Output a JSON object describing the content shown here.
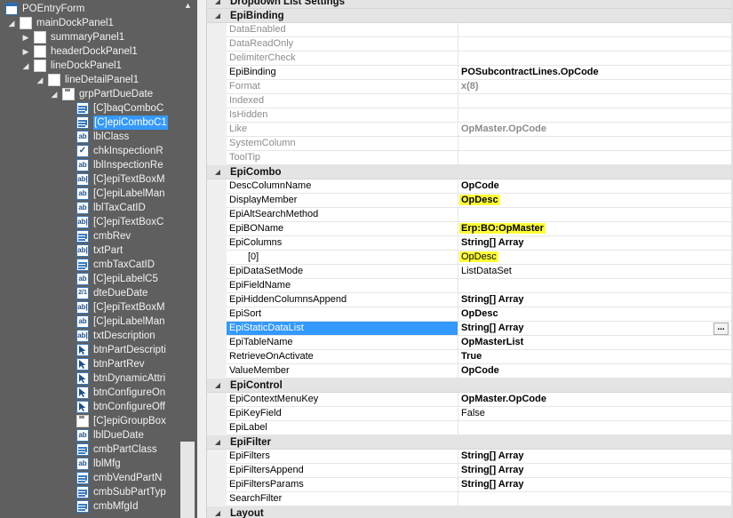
{
  "tree": {
    "nodes": [
      {
        "label": "POEntryForm",
        "icon": "form-icon",
        "expander": "",
        "level": 0
      },
      {
        "label": "mainDockPanel1",
        "icon": "panel-icon",
        "expander": "expanded",
        "level": 1
      },
      {
        "label": "summaryPanel1",
        "icon": "panel-icon",
        "expander": "collapsed",
        "level": 2
      },
      {
        "label": "headerDockPanel1",
        "icon": "panel-icon",
        "expander": "collapsed",
        "level": 2
      },
      {
        "label": "lineDockPanel1",
        "icon": "panel-icon",
        "expander": "expanded",
        "level": 2
      },
      {
        "label": "lineDetailPanel1",
        "icon": "panel-icon",
        "expander": "expanded",
        "level": 3
      },
      {
        "label": "grpPartDueDate",
        "icon": "group-icon",
        "expander": "expanded",
        "level": 4
      },
      {
        "label": "[C]baqComboC",
        "icon": "combo-icon",
        "expander": "",
        "level": 5
      },
      {
        "label": "[C]epiComboC1",
        "icon": "combo-icon",
        "expander": "",
        "level": 5,
        "selected": true
      },
      {
        "label": "lblClass",
        "icon": "label-icon",
        "expander": "",
        "level": 5
      },
      {
        "label": "chkInspectionR",
        "icon": "checkbox-icon",
        "expander": "",
        "level": 5
      },
      {
        "label": "lblInspectionRe",
        "icon": "label-icon",
        "expander": "",
        "level": 5
      },
      {
        "label": "[C]epiTextBoxM",
        "icon": "textbox-icon",
        "expander": "",
        "level": 5
      },
      {
        "label": "[C]epiLabelMan",
        "icon": "label-icon",
        "expander": "",
        "level": 5
      },
      {
        "label": "lblTaxCatID",
        "icon": "label-icon",
        "expander": "",
        "level": 5
      },
      {
        "label": "[C]epiTextBoxC",
        "icon": "textbox-icon",
        "expander": "",
        "level": 5
      },
      {
        "label": "cmbRev",
        "icon": "combo-icon",
        "expander": "",
        "level": 5
      },
      {
        "label": "txtPart",
        "icon": "textbox-icon",
        "expander": "",
        "level": 5
      },
      {
        "label": "cmbTaxCatID",
        "icon": "combo-icon",
        "expander": "",
        "level": 5
      },
      {
        "label": "[C]epiLabelC5",
        "icon": "label-icon",
        "expander": "",
        "level": 5
      },
      {
        "label": "dteDueDate",
        "icon": "date-icon",
        "expander": "",
        "level": 5
      },
      {
        "label": "[C]epiTextBoxM",
        "icon": "textbox-icon",
        "expander": "",
        "level": 5
      },
      {
        "label": "[C]epiLabelMan",
        "icon": "label-icon",
        "expander": "",
        "level": 5
      },
      {
        "label": "txtDescription",
        "icon": "textbox-icon",
        "expander": "",
        "level": 5
      },
      {
        "label": "btnPartDescripti",
        "icon": "button-icon",
        "expander": "",
        "level": 5
      },
      {
        "label": "btnPartRev",
        "icon": "button-icon",
        "expander": "",
        "level": 5
      },
      {
        "label": "btnDynamicAttri",
        "icon": "button-icon",
        "expander": "",
        "level": 5
      },
      {
        "label": "btnConfigureOn",
        "icon": "button-icon",
        "expander": "",
        "level": 5
      },
      {
        "label": "btnConfigureOff",
        "icon": "button-icon",
        "expander": "",
        "level": 5
      },
      {
        "label": "[C]epiGroupBox",
        "icon": "group-icon",
        "expander": "",
        "level": 5
      },
      {
        "label": "lblDueDate",
        "icon": "label-icon",
        "expander": "",
        "level": 5
      },
      {
        "label": "cmbPartClass",
        "icon": "combo-icon",
        "expander": "",
        "level": 5
      },
      {
        "label": "lblMfg",
        "icon": "label-icon",
        "expander": "",
        "level": 5
      },
      {
        "label": "cmbVendPartN",
        "icon": "combo-icon",
        "expander": "",
        "level": 5
      },
      {
        "label": "cmbSubPartTyp",
        "icon": "combo-icon",
        "expander": "",
        "level": 5
      },
      {
        "label": "cmbMfgId",
        "icon": "combo-icon",
        "expander": "",
        "level": 5
      }
    ]
  },
  "property_grid": {
    "rows": [
      {
        "kind": "category",
        "label": "Dropdown List Settings",
        "toggle": "expanded"
      },
      {
        "kind": "category",
        "label": "EpiBinding",
        "toggle": "expanded"
      },
      {
        "kind": "prop",
        "name": "DataEnabled",
        "value": "",
        "readonly": true
      },
      {
        "kind": "prop",
        "name": "DataReadOnly",
        "value": "",
        "readonly": true
      },
      {
        "kind": "prop",
        "name": "DelimiterCheck",
        "value": "",
        "readonly": true
      },
      {
        "kind": "prop",
        "name": "EpiBinding",
        "value": "POSubcontractLines.OpCode",
        "bold": true
      },
      {
        "kind": "prop",
        "name": "Format",
        "value": "x(8)",
        "readonly": true,
        "bold": true
      },
      {
        "kind": "prop",
        "name": "Indexed",
        "value": "",
        "readonly": true
      },
      {
        "kind": "prop",
        "name": "IsHidden",
        "value": "",
        "readonly": true
      },
      {
        "kind": "prop",
        "name": "Like",
        "value": "OpMaster.OpCode",
        "readonly": true,
        "bold": true
      },
      {
        "kind": "prop",
        "name": "SystemColumn",
        "value": "",
        "readonly": true
      },
      {
        "kind": "prop",
        "name": "ToolTip",
        "value": "",
        "readonly": true
      },
      {
        "kind": "category",
        "label": "EpiCombo",
        "toggle": "expanded"
      },
      {
        "kind": "prop",
        "name": "DescColumnName",
        "value": "OpCode",
        "bold": true
      },
      {
        "kind": "prop",
        "name": "DisplayMember",
        "value": "OpDesc",
        "bold": true,
        "highlight": true
      },
      {
        "kind": "prop",
        "name": "EpiAltSearchMethod",
        "value": ""
      },
      {
        "kind": "prop",
        "name": "EpiBOName",
        "value": "Erp:BO:OpMaster",
        "bold": true,
        "highlight": true
      },
      {
        "kind": "prop",
        "name": "EpiColumns",
        "value": "String[] Array",
        "bold": true
      },
      {
        "kind": "prop",
        "name": "[0]",
        "value": "OpDesc",
        "sub": true,
        "highlight": true
      },
      {
        "kind": "prop",
        "name": "EpiDataSetMode",
        "value": "ListDataSet"
      },
      {
        "kind": "prop",
        "name": "EpiFieldName",
        "value": ""
      },
      {
        "kind": "prop",
        "name": "EpiHiddenColumnsAppend",
        "value": "String[] Array",
        "bold": true
      },
      {
        "kind": "prop",
        "name": "EpiSort",
        "value": "OpDesc",
        "bold": true
      },
      {
        "kind": "prop",
        "name": "EpiStaticDataList",
        "value": "String[] Array",
        "bold": true,
        "selected": true,
        "ellipsis": "..."
      },
      {
        "kind": "prop",
        "name": "EpiTableName",
        "value": "OpMasterList",
        "bold": true
      },
      {
        "kind": "prop",
        "name": "RetrieveOnActivate",
        "value": "True",
        "bold": true
      },
      {
        "kind": "prop",
        "name": "ValueMember",
        "value": "OpCode",
        "bold": true
      },
      {
        "kind": "category",
        "label": "EpiControl",
        "toggle": "expanded"
      },
      {
        "kind": "prop",
        "name": "EpiContextMenuKey",
        "value": "OpMaster.OpCode",
        "bold": true
      },
      {
        "kind": "prop",
        "name": "EpiKeyField",
        "value": "False"
      },
      {
        "kind": "prop",
        "name": "EpiLabel",
        "value": ""
      },
      {
        "kind": "category",
        "label": "EpiFilter",
        "toggle": "expanded"
      },
      {
        "kind": "prop",
        "name": "EpiFilters",
        "value": "String[] Array",
        "bold": true
      },
      {
        "kind": "prop",
        "name": "EpiFiltersAppend",
        "value": "String[] Array",
        "bold": true
      },
      {
        "kind": "prop",
        "name": "EpiFiltersParams",
        "value": "String[] Array",
        "bold": true
      },
      {
        "kind": "prop",
        "name": "SearchFilter",
        "value": ""
      },
      {
        "kind": "category",
        "label": "Layout",
        "toggle": "expanded"
      }
    ]
  },
  "colors": {
    "tree_background": "#5f5f5f",
    "selection": "#3399ff",
    "highlight": "#ffff33"
  }
}
